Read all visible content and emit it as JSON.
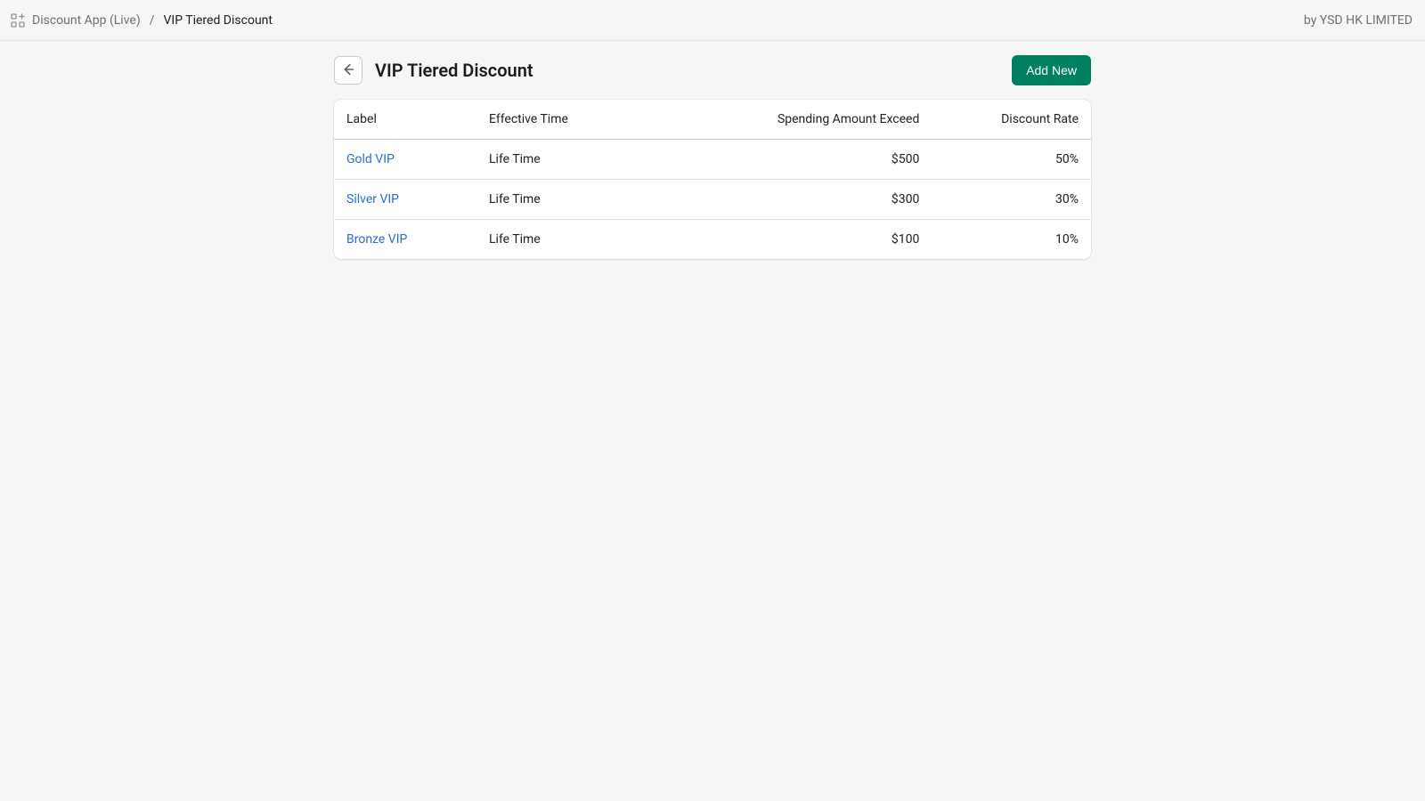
{
  "topbar": {
    "breadcrumb_app": "Discount App (Live)",
    "breadcrumb_sep": "/",
    "breadcrumb_current": "VIP Tiered Discount",
    "vendor": "by YSD HK LIMITED"
  },
  "header": {
    "title": "VIP Tiered Discount",
    "add_button": "Add New"
  },
  "table": {
    "columns": {
      "label": "Label",
      "effective_time": "Effective Time",
      "spending": "Spending Amount Exceed",
      "discount": "Discount Rate"
    },
    "rows": [
      {
        "label": "Gold VIP",
        "effective_time": "Life Time",
        "spending": "$500",
        "discount": "50%"
      },
      {
        "label": "Silver VIP",
        "effective_time": "Life Time",
        "spending": "$300",
        "discount": "30%"
      },
      {
        "label": "Bronze VIP",
        "effective_time": "Life Time",
        "spending": "$100",
        "discount": "10%"
      }
    ]
  }
}
